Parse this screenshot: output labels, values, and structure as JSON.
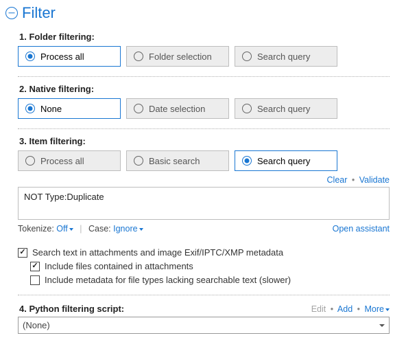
{
  "header": {
    "title": "Filter"
  },
  "sec1": {
    "label": "1. Folder filtering:",
    "options": [
      "Process all",
      "Folder selection",
      "Search query"
    ],
    "selected": 0
  },
  "sec2": {
    "label": "2. Native filtering:",
    "options": [
      "None",
      "Date selection",
      "Search query"
    ],
    "selected": 0
  },
  "sec3": {
    "label": "3. Item filtering:",
    "options": [
      "Process all",
      "Basic search",
      "Search query"
    ],
    "selected": 2,
    "actions": {
      "clear": "Clear",
      "validate": "Validate"
    },
    "query": "NOT Type:Duplicate",
    "under": {
      "tokenize_label": "Tokenize:",
      "tokenize_value": "Off",
      "case_label": "Case:",
      "case_value": "Ignore",
      "open_assistant": "Open assistant"
    }
  },
  "checks": {
    "c1": {
      "label": "Search text in attachments and image Exif/IPTC/XMP metadata",
      "checked": true
    },
    "c2": {
      "label": "Include files contained in attachments",
      "checked": true
    },
    "c3": {
      "label": "Include metadata for file types lacking searchable text (slower)",
      "checked": false
    }
  },
  "sec4": {
    "label": "4. Python filtering script:",
    "actions": {
      "edit": "Edit",
      "add": "Add",
      "more": "More"
    },
    "value": "(None)"
  }
}
